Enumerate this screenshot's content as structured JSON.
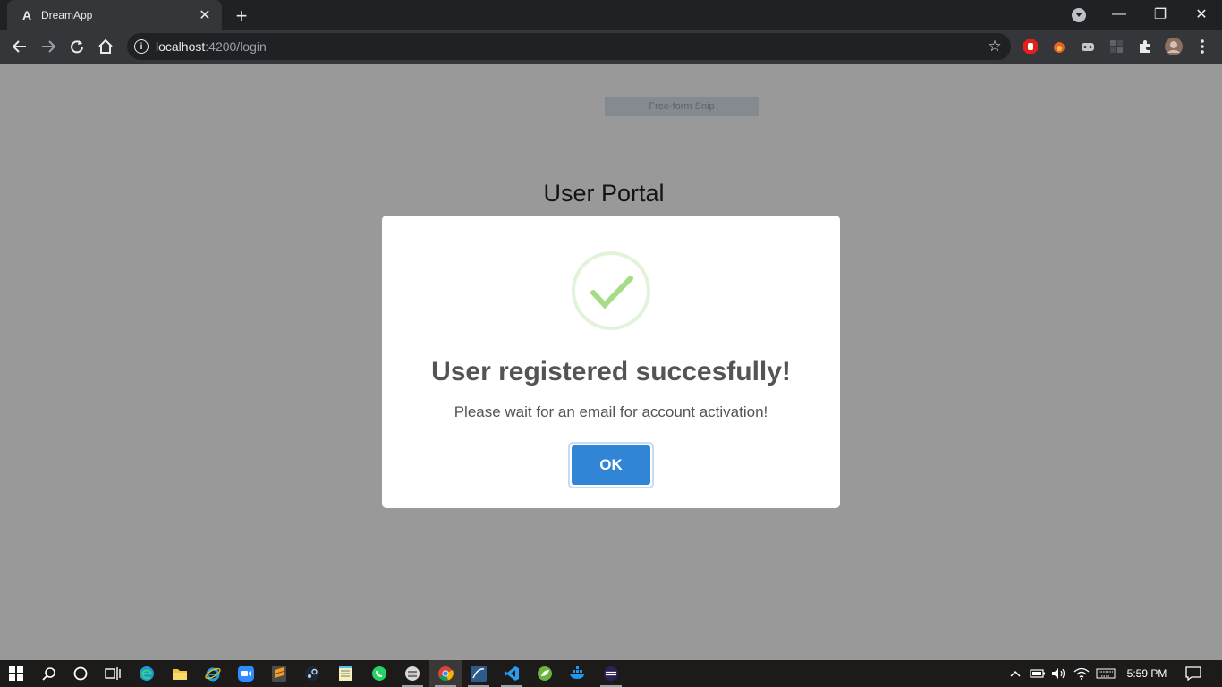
{
  "browser": {
    "tab": {
      "favicon": "A",
      "title": "DreamApp",
      "close": "✕"
    },
    "new_tab": "+",
    "window": {
      "minimize": "—",
      "restore": "❐",
      "close": "✕"
    },
    "omnibox": {
      "host": "localhost",
      "path": ":4200/login"
    }
  },
  "page": {
    "title": "User Portal",
    "snip_tooltip": "Free-form Snip"
  },
  "dialog": {
    "title": "User registered succesfully!",
    "text": "Please wait for an email for account activation!",
    "ok_label": "OK"
  },
  "taskbar": {
    "apps": [
      "start",
      "search",
      "cortana",
      "task-view",
      "edge",
      "file-explorer",
      "internet-explorer",
      "zoom",
      "sublime-text",
      "steam",
      "notepad",
      "whatsapp",
      "app",
      "chrome",
      "app",
      "vscode",
      "spring-tool",
      "docker",
      "app"
    ],
    "clock": "5:59 PM"
  }
}
